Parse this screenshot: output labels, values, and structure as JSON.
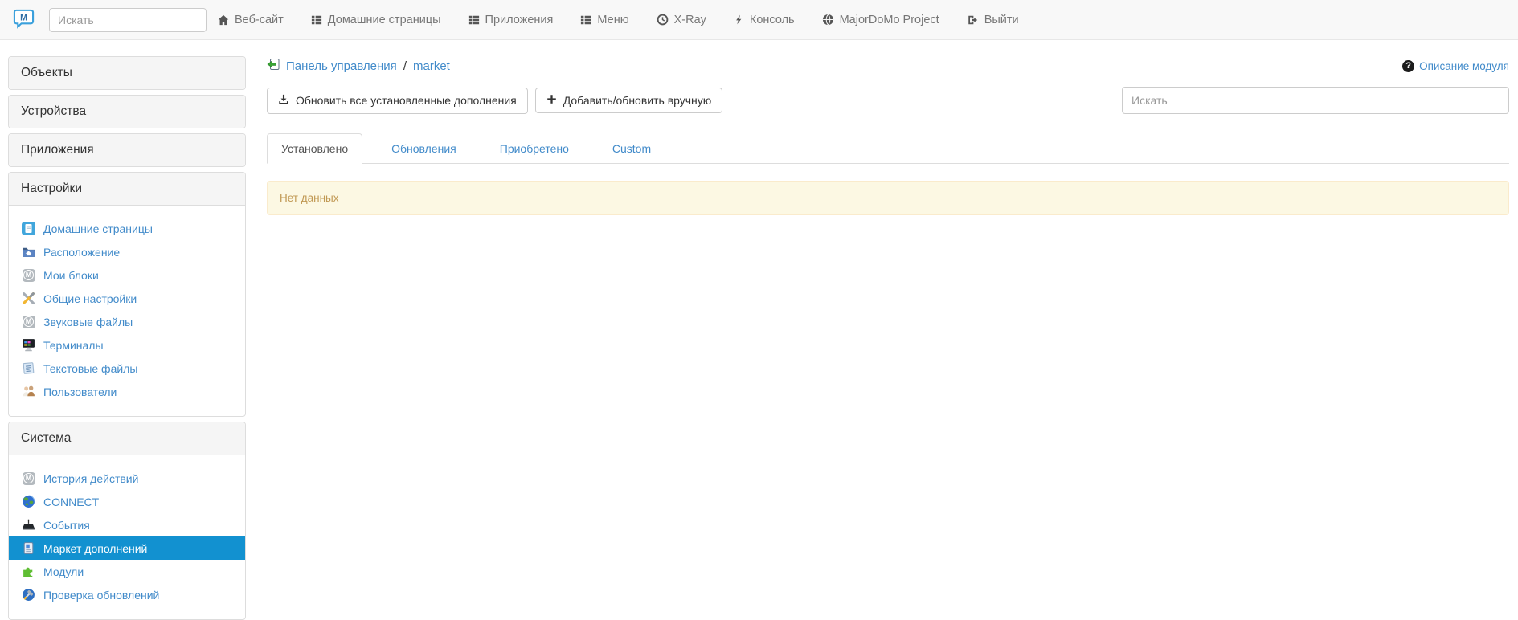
{
  "topnav": {
    "search_placeholder": "Искать",
    "items": [
      {
        "label": "Веб-сайт",
        "icon": "home-icon"
      },
      {
        "label": "Домашние страницы",
        "icon": "list-icon"
      },
      {
        "label": "Приложения",
        "icon": "list-icon"
      },
      {
        "label": "Меню",
        "icon": "list-icon"
      },
      {
        "label": "X-Ray",
        "icon": "clock-icon"
      },
      {
        "label": "Консоль",
        "icon": "bolt-icon"
      },
      {
        "label": "MajorDoMo Project",
        "icon": "globe-icon"
      },
      {
        "label": "Выйти",
        "icon": "logout-icon"
      }
    ]
  },
  "sidebar": {
    "sections": [
      {
        "title": "Объекты",
        "collapsed": true
      },
      {
        "title": "Устройства",
        "collapsed": true
      },
      {
        "title": "Приложения",
        "collapsed": true
      },
      {
        "title": "Настройки",
        "collapsed": false,
        "items": [
          {
            "label": "Домашние страницы",
            "icon": "document-icon"
          },
          {
            "label": "Расположение",
            "icon": "folder-home-icon"
          },
          {
            "label": "Мои блоки",
            "icon": "majordomo-m-icon"
          },
          {
            "label": "Общие настройки",
            "icon": "tools-icon"
          },
          {
            "label": "Звуковые файлы",
            "icon": "majordomo-m-icon"
          },
          {
            "label": "Терминалы",
            "icon": "monitor-icon"
          },
          {
            "label": "Текстовые файлы",
            "icon": "notepad-icon"
          },
          {
            "label": "Пользователи",
            "icon": "users-icon"
          }
        ]
      },
      {
        "title": "Система",
        "collapsed": false,
        "items": [
          {
            "label": "История действий",
            "icon": "majordomo-m-icon"
          },
          {
            "label": "CONNECT",
            "icon": "earth-icon"
          },
          {
            "label": "События",
            "icon": "device-icon"
          },
          {
            "label": "Маркет дополнений",
            "icon": "market-icon",
            "active": true
          },
          {
            "label": "Модули",
            "icon": "puzzle-icon"
          },
          {
            "label": "Проверка обновлений",
            "icon": "update-check-icon"
          }
        ]
      }
    ]
  },
  "main": {
    "breadcrumb": {
      "root": "Панель управления",
      "separator": "/",
      "current": "market"
    },
    "help_link": "Описание модуля",
    "buttons": {
      "update_all": "Обновить все установленные дополнения",
      "add_manual": "Добавить/обновить вручную"
    },
    "search_placeholder": "Искать",
    "tabs": [
      {
        "label": "Установлено",
        "active": true
      },
      {
        "label": "Обновления",
        "active": false
      },
      {
        "label": "Приобретено",
        "active": false
      },
      {
        "label": "Custom",
        "active": false
      }
    ],
    "alert_text": "Нет данных"
  },
  "colors": {
    "link": "#428bca",
    "active_bg": "#1291d0",
    "active_fg": "#ffffff",
    "alert_bg": "#fcf8e3",
    "alert_border": "#faebcc",
    "alert_text": "#c09853",
    "panel_head_bg": "#f5f5f5",
    "border": "#dddddd",
    "navbar_bg": "#f8f8f8",
    "nav_text": "#777777"
  }
}
